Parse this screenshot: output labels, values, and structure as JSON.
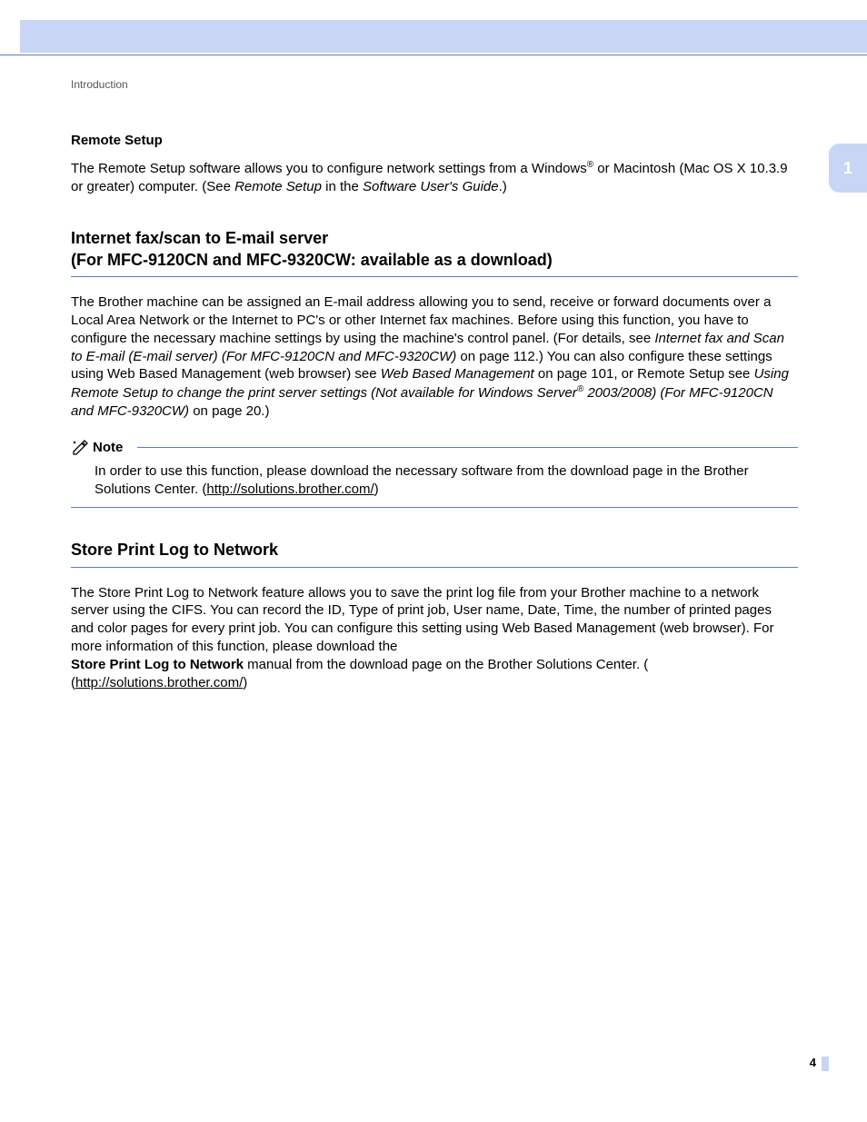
{
  "breadcrumb": "Introduction",
  "side_tab": "1",
  "page_number": "4",
  "remote_setup": {
    "heading": "Remote Setup",
    "p1_a": "The Remote Setup software allows you to configure network settings from a Windows",
    "p1_sup": "®",
    "p1_b": " or Macintosh (Mac OS X 10.3.9 or greater) computer. (See ",
    "p1_i1": "Remote Setup",
    "p1_c": " in the ",
    "p1_i2": "Software User's Guide",
    "p1_d": ".)"
  },
  "internet_fax": {
    "heading_l1": "Internet fax/scan to E-mail server",
    "heading_l2": "(For MFC-9120CN and MFC-9320CW: available as a download)",
    "p1_a": "The Brother machine can be assigned an E-mail address allowing you to send, receive or forward documents over a Local Area Network or the Internet to PC's or other Internet fax machines. Before using this function, you have to configure the necessary machine settings by using the machine's control panel. (For details, see ",
    "p1_i1": "Internet fax and Scan to E-mail (E-mail server) (For MFC-9120CN and MFC-9320CW)",
    "p1_b": " on page 112.) You can also configure these settings using Web Based Management (web browser) see ",
    "p1_i2": "Web Based Management",
    "p1_c": " on page 101, or Remote Setup see ",
    "p1_i3a": "Using Remote Setup to change the print server settings (Not available for Windows Server",
    "p1_sup": "®",
    "p1_i3b": " 2003/2008) (For MFC-9120CN and MFC-9320CW)",
    "p1_d": " on page 20.)",
    "note_label": "Note",
    "note_a": "In order to use this function, please download the necessary software from the download page in the Brother Solutions Center. (",
    "note_link": "http://solutions.brother.com/",
    "note_b": ")"
  },
  "store_print": {
    "heading": "Store Print Log to Network",
    "p1_a": "The Store Print Log to Network feature allows you to save the print log file from your Brother machine to a network server using the CIFS. You can record the ID, Type of print job, User name, Date, Time, the number of printed pages and color pages for every print job. You can configure this setting using Web Based Management (web browser). For more information of this function, please download the ",
    "p1_bold": "Store Print Log to Network",
    "p1_b": " manual from the download page on the Brother Solutions Center. (",
    "p1_link": "http://solutions.brother.com/",
    "p1_c": ")"
  }
}
